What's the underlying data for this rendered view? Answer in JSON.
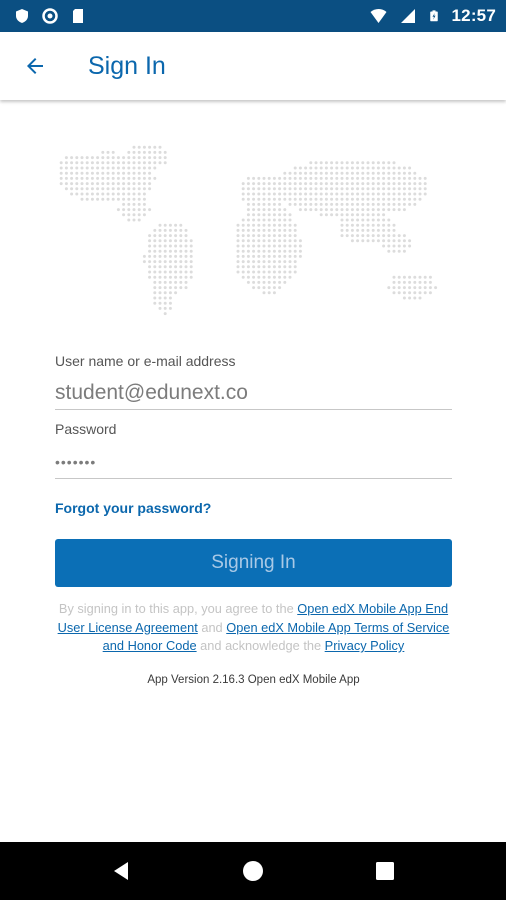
{
  "status_bar": {
    "time": "12:57",
    "left_icons": [
      "shield-icon",
      "circle-icon",
      "sd-card-icon"
    ],
    "right_icons": [
      "wifi-icon",
      "signal-icon",
      "battery-icon"
    ]
  },
  "app_bar": {
    "title": "Sign In",
    "back_icon": "arrow-left-icon"
  },
  "form": {
    "username_label": "User name or e-mail address",
    "username_value": "student@edunext.co",
    "password_label": "Password",
    "password_value": "•••••••",
    "forgot_link": "Forgot your password?",
    "signin_button": "Signing In"
  },
  "agreement": {
    "text_1": "By signing in to this app, you agree to the",
    "link_1": "Open edX Mobile App End User License Agreement",
    "text_2": "and",
    "link_2": "Open edX Mobile App Terms of Service and Honor Code",
    "text_3": "and acknowledge the",
    "link_3": "Privacy Policy"
  },
  "app_version": "App Version 2.16.3 Open edX Mobile App",
  "colors": {
    "status_bar": "#0b4f82",
    "accent": "#0b67ad",
    "button": "#0b6fb6"
  },
  "nav_bar": {
    "icons": [
      "back-triangle-icon",
      "home-circle-icon",
      "recents-square-icon"
    ]
  }
}
